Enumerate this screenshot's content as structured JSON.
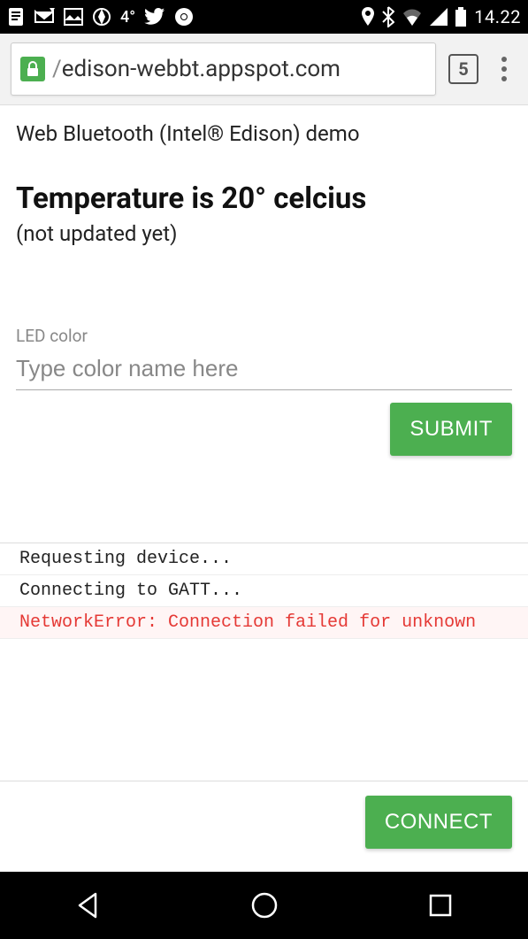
{
  "status_bar": {
    "temp": "4°",
    "clock": "14.22"
  },
  "browser": {
    "url": "edison-webbt.appspot.com",
    "tab_count": "5"
  },
  "page": {
    "subtitle": "Web Bluetooth (Intel® Edison) demo",
    "title": "Temperature is 20° celcius",
    "note": "(not updated yet)"
  },
  "form": {
    "label": "LED color",
    "placeholder": "Type color name here",
    "value": "",
    "submit_label": "SUBMIT"
  },
  "log": [
    {
      "text": "Requesting device...",
      "error": false
    },
    {
      "text": "Connecting to GATT...",
      "error": false
    },
    {
      "text": "NetworkError: Connection failed for unknown",
      "error": true
    }
  ],
  "connect_label": "CONNECT"
}
